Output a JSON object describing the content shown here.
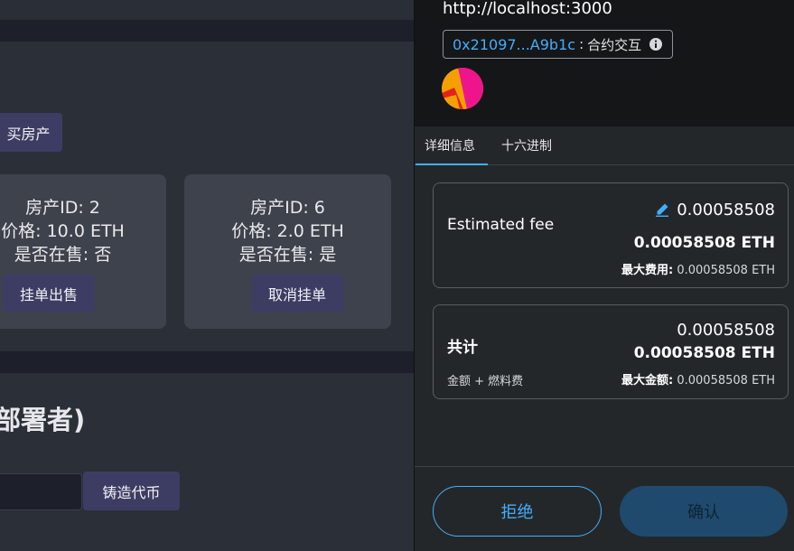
{
  "app": {
    "buy_button": "买房产",
    "cards": [
      {
        "line1": "房产ID: 2",
        "line2": "价格: 10.0 ETH",
        "line3": "是否在售: 否",
        "action": "挂单出售"
      },
      {
        "line1": "房产ID: 6",
        "line2": "价格: 2.0 ETH",
        "line3": "是否在售: 是",
        "action": "取消挂单"
      }
    ],
    "section_title": "部署者)",
    "mint_button": "铸造代币"
  },
  "popup": {
    "origin": "http://localhost:3000",
    "contract_address": "0x21097...A9b1c",
    "separator": ":",
    "interaction": "合约交互",
    "tabs": [
      "详细信息",
      "十六进制"
    ],
    "active_tab": 0,
    "fee": {
      "label": "Estimated fee",
      "value": "0.00058508",
      "value_eth": "0.00058508 ETH",
      "max_label": "最大费用:",
      "max_value": "0.00058508 ETH"
    },
    "total": {
      "label": "共计",
      "sub_label": "金额 + 燃料费",
      "value": "0.00058508",
      "value_eth": "0.00058508 ETH",
      "max_label": "最大金额:",
      "max_value": "0.00058508 ETH"
    },
    "reject_button": "拒绝",
    "confirm_button": "确认"
  },
  "colors": {
    "accent": "#43aefc",
    "app_button": "#3d3d63",
    "confirm_disabled": "#1f4a6d"
  },
  "icons": [
    "info-icon",
    "edit-pencil-icon",
    "account-avatar-icon"
  ]
}
